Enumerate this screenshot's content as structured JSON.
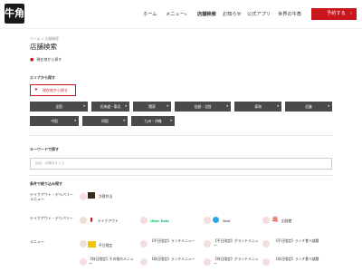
{
  "header": {
    "logo_text": "牛角",
    "nav": [
      "ホーム",
      "メニュー",
      "店舗検索",
      "お知らせ",
      "公式アプリ",
      "世界の牛角"
    ],
    "menu_chevron": "∨",
    "reserve_label": "予約する",
    "reserve_arrow": "›"
  },
  "breadcrumb": {
    "home": "ホーム",
    "sep": ">",
    "current": "店舗検索"
  },
  "page_title": "店舗検索",
  "locate_label": "現在地から探す",
  "area": {
    "section_label": "エリアから探す",
    "near_button": "現在地から探す",
    "regions": [
      "全国",
      "北海道・東北",
      "関東",
      "信越・北陸",
      "東海",
      "近畿",
      "中国",
      "四国",
      "九州・沖縄"
    ]
  },
  "keyword": {
    "section_label": "キーワードで探す",
    "placeholder": "地名・店舗名を入力"
  },
  "conditions": {
    "section_label": "条件で絞り込み探す",
    "rows": [
      {
        "label": "テイクアウト・デリバリーメニュー",
        "options": [
          "冷蔵弁当"
        ]
      },
      {
        "label": "テイクアウト・デリバリー",
        "options": [
          "テイクアウト",
          "Uber Eats",
          "Wolt",
          "出前館"
        ]
      },
      {
        "label": "メニュー",
        "options": [
          "平日限定",
          "【平日限定】ランチメニュー",
          "【平日限定】グランドメニュー",
          "【平日限定】ランチ食べ放題"
        ]
      },
      {
        "label": "",
        "options": [
          "【休日限定】その他のメニュー",
          "【休日限定】ランチメニュー",
          "【休日限定】グランドメニュー",
          "【休日限定】ランチ食べ放題"
        ]
      }
    ]
  },
  "colors": {
    "accent": "#c9161d",
    "region_bg": "#4a4a4a"
  }
}
